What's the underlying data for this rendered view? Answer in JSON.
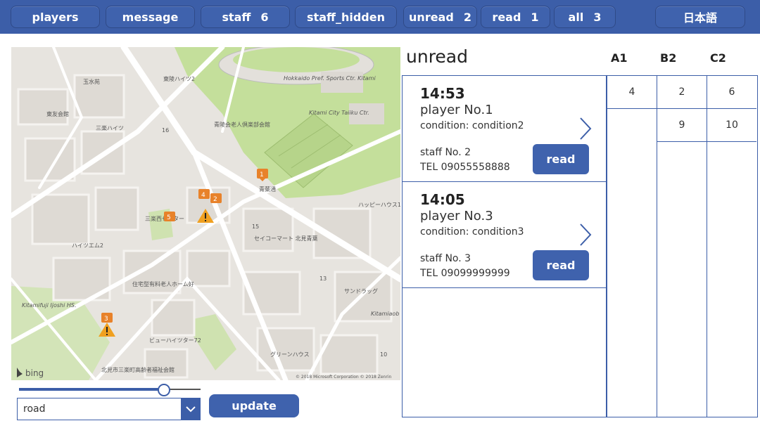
{
  "topbar": {
    "buttons": [
      {
        "label": "players",
        "count": ""
      },
      {
        "label": "message",
        "count": ""
      },
      {
        "label": "staff",
        "count": "6"
      },
      {
        "label": "staff_hidden",
        "count": ""
      },
      {
        "label": "unread",
        "count": "2"
      },
      {
        "label": "read",
        "count": "1"
      },
      {
        "label": "all",
        "count": "3"
      }
    ],
    "language": "日本語"
  },
  "map": {
    "labels": [
      "玉水苑",
      "東陵ハイツ2",
      "Hokkaido Pref. Sports Ctr. Kitami",
      "Kitami City Taiiku Ctr.",
      "東友会館",
      "三楽ハイツ",
      "青陵会老人倶楽部会館",
      "青葉通",
      "ハッピーハウス1",
      "三楽西センター",
      "ハイツエム2",
      "セイコーマート 北見青葉",
      "住宅型有料老人ホーム好",
      "サンドラッグ",
      "Kitamifuji Ijoshi HS.",
      "ビューハイツター72",
      "グリーンハウス",
      "北見市三楽町高齢者福祉会館",
      "Kitamiaob"
    ],
    "attribution": "© 2018 Microsoft Corporation © 2018 Zenrin",
    "brand": "bing",
    "road_numbers": [
      "16",
      "15",
      "13",
      "10"
    ],
    "markers": [
      "1",
      "2",
      "3",
      "4",
      "5"
    ]
  },
  "controls": {
    "slider_value": 0.8,
    "map_style": "road",
    "update_label": "update"
  },
  "panel": {
    "title": "unread",
    "read_label": "read",
    "messages": [
      {
        "time": "14:53",
        "player": "player No.1",
        "condition": "condition: condition2",
        "staff": "staff No. 2",
        "tel": "TEL 09055558888"
      },
      {
        "time": "14:05",
        "player": "player No.3",
        "condition": "condition: condition3",
        "staff": "staff No. 3",
        "tel": "TEL 09099999999"
      }
    ]
  },
  "grid": {
    "headers": [
      "A1",
      "B2",
      "C2"
    ],
    "columns": [
      [
        "4"
      ],
      [
        "2",
        "9"
      ],
      [
        "6",
        "10"
      ]
    ]
  },
  "colors": {
    "accent": "#3c5ea8",
    "marker": "#e8822a",
    "park": "#c4df9b"
  }
}
